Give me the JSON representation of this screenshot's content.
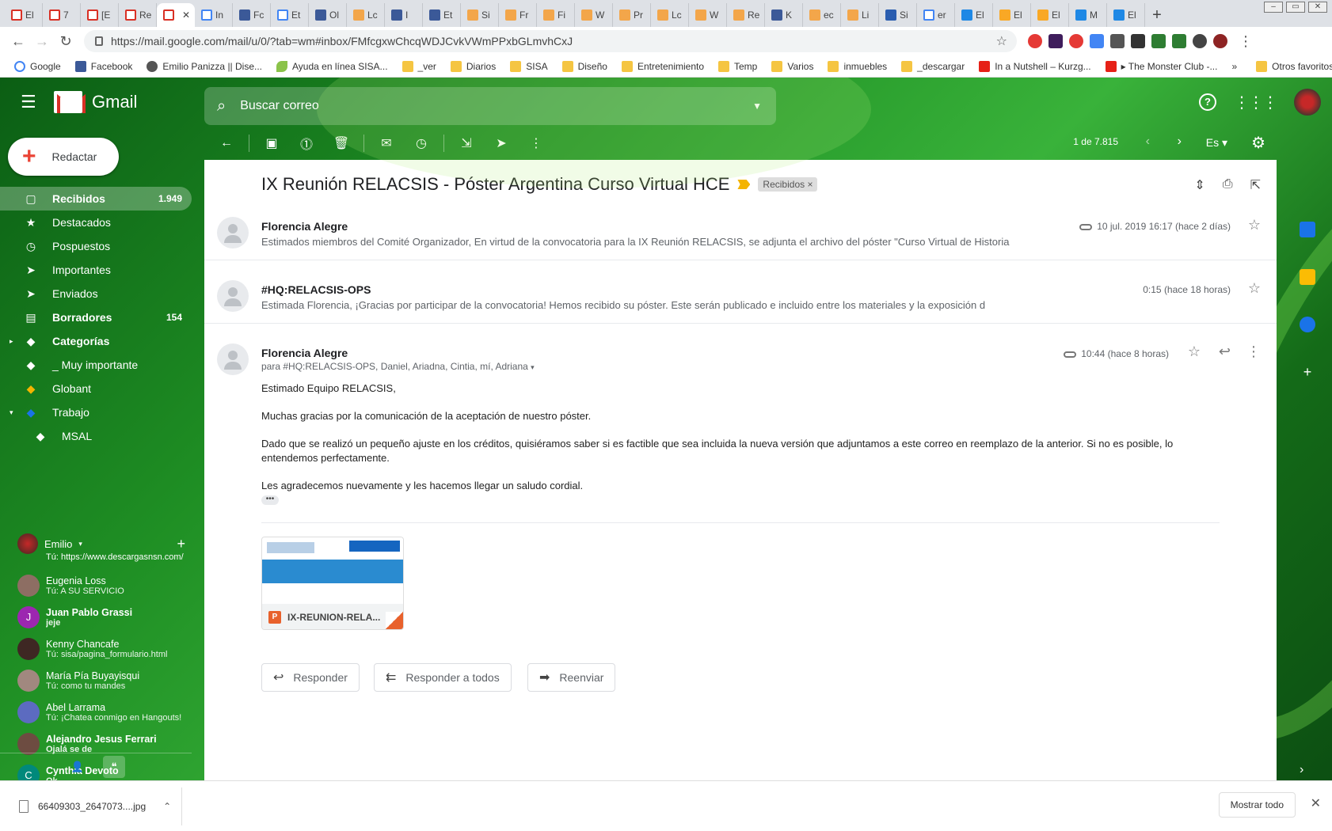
{
  "browser": {
    "tabs": [
      {
        "title": "El",
        "icon": "gmail"
      },
      {
        "title": "7",
        "icon": "gmail"
      },
      {
        "title": "[E",
        "icon": "gmail"
      },
      {
        "title": "Re",
        "icon": "gmail"
      },
      {
        "title": "",
        "icon": "gmail",
        "active": true
      },
      {
        "title": "In",
        "icon": "google"
      },
      {
        "title": "Fc",
        "icon": "facebook"
      },
      {
        "title": "Et",
        "icon": "maps"
      },
      {
        "title": "Ol",
        "icon": "facebook"
      },
      {
        "title": "Lc",
        "icon": "people"
      },
      {
        "title": "I",
        "icon": "facebook"
      },
      {
        "title": "Et",
        "icon": "facebook"
      },
      {
        "title": "Si",
        "icon": "people"
      },
      {
        "title": "Fr",
        "icon": "people"
      },
      {
        "title": "Fi",
        "icon": "people"
      },
      {
        "title": "W",
        "icon": "people"
      },
      {
        "title": "Pr",
        "icon": "people"
      },
      {
        "title": "Lc",
        "icon": "people"
      },
      {
        "title": "W",
        "icon": "people"
      },
      {
        "title": "Re",
        "icon": "people"
      },
      {
        "title": "K",
        "icon": "facebook"
      },
      {
        "title": "ec",
        "icon": "people"
      },
      {
        "title": "Li",
        "icon": "people"
      },
      {
        "title": "Si",
        "icon": "keybase"
      },
      {
        "title": "er",
        "icon": "google"
      },
      {
        "title": "El",
        "icon": "mail"
      },
      {
        "title": "El",
        "icon": "yellow"
      },
      {
        "title": "El",
        "icon": "yellow"
      },
      {
        "title": "M",
        "icon": "mail"
      },
      {
        "title": "El",
        "icon": "mail"
      }
    ],
    "url": "https://mail.google.com/mail/u/0/?tab=wm#inbox/FMfcgxwChcqWDJCvkVWmPPxbGLmvhCxJ",
    "bookmarks": [
      {
        "label": "Google",
        "icon": "google"
      },
      {
        "label": "Facebook",
        "icon": "facebook"
      },
      {
        "label": "Emilio Panizza || Dise...",
        "icon": "globe"
      },
      {
        "label": "Ayuda en línea SISA...",
        "icon": "leaf"
      },
      {
        "label": "_ver",
        "icon": "folder"
      },
      {
        "label": "Diarios",
        "icon": "folder"
      },
      {
        "label": "SISA",
        "icon": "folder"
      },
      {
        "label": "Diseño",
        "icon": "folder"
      },
      {
        "label": "Entretenimiento",
        "icon": "folder"
      },
      {
        "label": "Temp",
        "icon": "folder"
      },
      {
        "label": "Varios",
        "icon": "folder"
      },
      {
        "label": "inmuebles",
        "icon": "folder"
      },
      {
        "label": "_descargar",
        "icon": "folder"
      },
      {
        "label": "In a Nutshell – Kurzg...",
        "icon": "youtube"
      },
      {
        "label": "▸ The Monster Club -...",
        "icon": "youtube"
      }
    ],
    "bookmarks_more": "»",
    "other_bookmarks": "Otros favoritos"
  },
  "gmail": {
    "logo_text": "Gmail",
    "search_placeholder": "Buscar correo",
    "compose_label": "Redactar",
    "nav": [
      {
        "label": "Recibidos",
        "count": "1.949",
        "icon": "inbox-icon",
        "active": true
      },
      {
        "label": "Destacados",
        "count": "",
        "icon": "star-icon"
      },
      {
        "label": "Pospuestos",
        "count": "",
        "icon": "clock-icon"
      },
      {
        "label": "Importantes",
        "count": "",
        "icon": "important-icon"
      },
      {
        "label": "Enviados",
        "count": "",
        "icon": "send-icon"
      },
      {
        "label": "Borradores",
        "count": "154",
        "icon": "draft-icon",
        "bold": true
      },
      {
        "label": "Categorías",
        "count": "",
        "icon": "label-icon",
        "bold": true,
        "expander": "▸"
      },
      {
        "label": "_ Muy importante",
        "count": "",
        "icon": "label-icon"
      },
      {
        "label": "Globant",
        "count": "",
        "icon": "label-icon",
        "color": "#f4b400"
      },
      {
        "label": "Trabajo",
        "count": "",
        "icon": "label-icon",
        "color": "#1a73e8",
        "expander": "▾"
      },
      {
        "label": "MSAL",
        "count": "",
        "icon": "label-icon",
        "indent": true
      }
    ],
    "hangouts_user": "Emilio",
    "hangouts_partial": {
      "prefix": "Tú: ",
      "link": "https://www.descargasnsn.com/"
    },
    "hangouts": [
      {
        "name": "Eugenia Loss",
        "snippet": "Tú: A SU SERVICIO",
        "initial": "",
        "color": "#8d6e63",
        "bold": false
      },
      {
        "name": "Juan Pablo Grassi",
        "snippet": "jeje",
        "initial": "J",
        "color": "#9c27b0",
        "bold": true
      },
      {
        "name": "Kenny Chancafe",
        "snippet": "Tú: sisa/pagina_formulario.html",
        "initial": "",
        "color": "#3e2723",
        "bold": false
      },
      {
        "name": "María Pía Buyayisqui",
        "snippet": "Tú: como tu mandes",
        "initial": "",
        "color": "#a1887f",
        "bold": false
      },
      {
        "name": "Abel Larrama",
        "snippet": "Tú: ¡Chatea conmigo en Hangouts!",
        "initial": "",
        "color": "#5c6bc0",
        "bold": false
      },
      {
        "name": "Alejandro Jesus Ferrari",
        "snippet": "Ojalá se de",
        "initial": "",
        "color": "#6d4c41",
        "bold": true
      },
      {
        "name": "Cynthia Devoto",
        "snippet": "Ok",
        "initial": "C",
        "color": "#00897b",
        "bold": true
      }
    ],
    "pager": "1 de 7.815",
    "lang": "Es ▾"
  },
  "thread": {
    "subject": "IX Reunión RELACSIS - Póster Argentina Curso Virtual HCE",
    "label": "Recibidos ×",
    "messages": [
      {
        "from": "Florencia Alegre",
        "snippet": "Estimados miembros del Comité Organizador, En virtud de la convocatoria para la IX Reunión RELACSIS, se adjunta el archivo del póster \"Curso Virtual de Historia",
        "date": "10 jul. 2019 16:17 (hace 2 días)"
      },
      {
        "from": "#HQ:RELACSIS-OPS",
        "snippet": "Estimada Florencia, ¡Gracias por participar de la convocatoria! Hemos recibido su póster. Este serán publicado e incluido entre los materiales y la exposición d",
        "date": "0:15 (hace 18 horas)"
      }
    ],
    "open": {
      "from": "Florencia Alegre",
      "to": "para #HQ:RELACSIS-OPS, Daniel, Ariadna, Cintia, mí, Adriana",
      "date": "10:44 (hace 8 horas)",
      "body": [
        "Estimado Equipo RELACSIS,",
        "Muchas gracias por la comunicación de la aceptación de nuestro póster.",
        "Dado que se realizó un pequeño ajuste en los créditos, quisiéramos saber si es factible que sea incluida la nueva versión que adjuntamos a este correo en reemplazo de la anterior. Si no es posible, lo entendemos perfectamente.",
        "Les agradecemos nuevamente y les hacemos llegar un saludo cordial."
      ],
      "ellipsis": "•••",
      "attachment": {
        "name": "IX-REUNION-RELA...",
        "type": "P"
      }
    },
    "actions": {
      "reply": "Responder",
      "reply_all": "Responder a todos",
      "forward": "Reenviar"
    }
  },
  "downloads": {
    "file": "66409303_2647073....jpg",
    "show_all": "Mostrar todo"
  }
}
